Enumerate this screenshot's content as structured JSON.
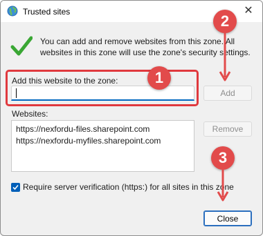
{
  "window": {
    "title": "Trusted sites"
  },
  "message": "You can add and remove websites from this zone. All websites in this zone will use the zone's security settings.",
  "add_field": {
    "label": "Add this website to the zone:",
    "value": ""
  },
  "buttons": {
    "add": "Add",
    "remove": "Remove",
    "close": "Close"
  },
  "websites": {
    "label": "Websites:",
    "items": [
      "https://nexfordu-files.sharepoint.com",
      "https://nexfordu-myfiles.sharepoint.com"
    ]
  },
  "verify": {
    "label": "Require server verification (https:) for all sites in this zone",
    "checked": true
  },
  "annotations": {
    "marker1": "1",
    "marker2": "2",
    "marker3": "3"
  },
  "colors": {
    "annotation_red": "#e24b4b",
    "accent_blue": "#005fb8",
    "check_green": "#3aa734"
  },
  "icons": [
    "globe-icon",
    "close-icon",
    "checkmark-icon",
    "checkbox-check-icon",
    "arrow-down-icon"
  ]
}
